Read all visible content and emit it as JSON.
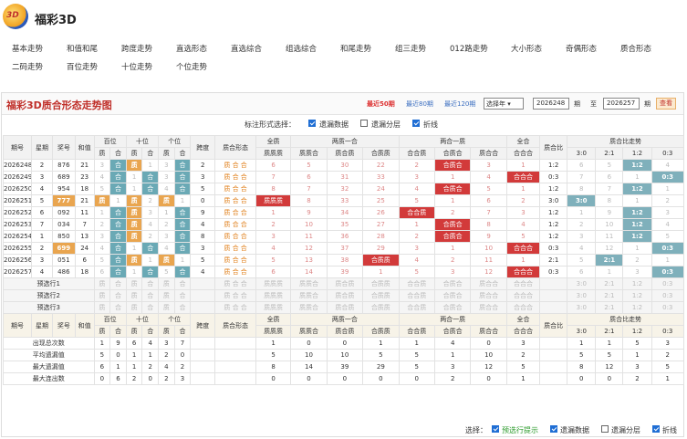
{
  "brand": {
    "logo": "3D",
    "name": "福彩3D"
  },
  "nav": {
    "row1": [
      "基本走势",
      "和值和尾",
      "跨度走势",
      "直选形态",
      "直选综合",
      "组选综合",
      "和尾走势",
      "组三走势",
      "012路走势",
      "大小形态",
      "奇偶形态",
      "质合形态"
    ],
    "row2": [
      "二码走势",
      "百位走势",
      "十位走势",
      "个位走势"
    ]
  },
  "panel": {
    "title": "福彩3D质合形态走势图",
    "recent50": "最近50期",
    "recent80": "最近80期",
    "recent120": "最近120期",
    "select": "选择年",
    "from": "2026248",
    "qi1": "期",
    "to_label": "至",
    "to": "2026257",
    "qi2": "期",
    "query": "查看"
  },
  "options": {
    "label": "标注形式选择：",
    "o1": "遗漏数据",
    "o2": "遗漏分层",
    "o3": "折线"
  },
  "head": {
    "issue": "期号",
    "week": "星期",
    "prize": "奖号",
    "sum": "和值",
    "bai": "百位",
    "shi": "十位",
    "ge": "个位",
    "span": "跨度",
    "form": "质合形态",
    "quan": "全质",
    "lzyh": "两质一合",
    "lhyz": "两合一质",
    "quanhe": "全合",
    "ratio": "质合比",
    "trend": "质合比走势",
    "zhi": "质",
    "he": "合",
    "qz": "质质质",
    "zzh": "质质合",
    "zhz": "质合质",
    "hzz": "合质质",
    "hhz": "合合质",
    "hzh": "合质合",
    "zhh": "质合合",
    "hhh": "合合合",
    "r30": "3:0",
    "r21": "2:1",
    "r12": "1:2",
    "r03": "0:3"
  },
  "rows": [
    [
      "2026248",
      "2",
      "876",
      "21",
      "3",
      "合",
      "质",
      "1",
      "3",
      "合",
      "2",
      "6",
      "5",
      "30",
      "22",
      "2",
      "合质合",
      "3",
      "1",
      "1:2",
      "6",
      "5",
      "1:2",
      "4"
    ],
    [
      "2026249",
      "3",
      "689",
      "23",
      "4",
      "合",
      "1",
      "合",
      "3",
      "合",
      "3",
      "7",
      "6",
      "31",
      "33",
      "3",
      "1",
      "4",
      "合合合",
      "0:3",
      "7",
      "6",
      "1",
      "0:3"
    ],
    [
      "2026250",
      "4",
      "954",
      "18",
      "5",
      "合",
      "1",
      "合",
      "4",
      "合",
      "5",
      "8",
      "7",
      "32",
      "24",
      "4",
      "合质合",
      "5",
      "1",
      "1:2",
      "8",
      "7",
      "1:2",
      "1"
    ],
    [
      "2026251",
      "5",
      "777",
      "21",
      "质",
      "1",
      "质",
      "2",
      "质",
      "1",
      "0",
      "质质质",
      "8",
      "33",
      "25",
      "5",
      "1",
      "6",
      "2",
      "3:0",
      "3:0",
      "8",
      "1",
      "2"
    ],
    [
      "2026252",
      "6",
      "092",
      "11",
      "1",
      "合",
      "质",
      "3",
      "1",
      "合",
      "9",
      "1",
      "9",
      "34",
      "26",
      "合合质",
      "2",
      "7",
      "3",
      "1:2",
      "1",
      "9",
      "1:2",
      "3"
    ],
    [
      "2026253",
      "7",
      "034",
      "7",
      "2",
      "合",
      "质",
      "4",
      "2",
      "合",
      "4",
      "2",
      "10",
      "35",
      "27",
      "1",
      "合质合",
      "8",
      "4",
      "1:2",
      "2",
      "10",
      "1:2",
      "4"
    ],
    [
      "2026254",
      "1",
      "850",
      "13",
      "3",
      "合",
      "质",
      "2",
      "3",
      "合",
      "8",
      "3",
      "11",
      "36",
      "28",
      "2",
      "合质合",
      "9",
      "5",
      "1:2",
      "3",
      "11",
      "1:2",
      "5"
    ],
    [
      "2026255",
      "2",
      "699",
      "24",
      "4",
      "合",
      "1",
      "合",
      "4",
      "合",
      "3",
      "4",
      "12",
      "37",
      "29",
      "3",
      "1",
      "10",
      "合合合",
      "0:3",
      "4",
      "12",
      "1",
      "0:3"
    ],
    [
      "2026256",
      "3",
      "051",
      "6",
      "5",
      "合",
      "质",
      "1",
      "质",
      "1",
      "5",
      "5",
      "13",
      "38",
      "合质质",
      "4",
      "2",
      "11",
      "1",
      "2:1",
      "5",
      "2:1",
      "2",
      "1"
    ],
    [
      "2026257",
      "4",
      "486",
      "18",
      "6",
      "合",
      "1",
      "合",
      "5",
      "合",
      "4",
      "6",
      "14",
      "39",
      "1",
      "5",
      "3",
      "12",
      "合合合",
      "0:3",
      "6",
      "1",
      "3",
      "0:3"
    ]
  ],
  "predict": [
    "预选行1",
    "预选行2",
    "预选行3"
  ],
  "stats": [
    [
      "出现总次数",
      "1",
      "9",
      "6",
      "4",
      "3",
      "7",
      "",
      "",
      "",
      "1",
      "0",
      "0",
      "1",
      "1",
      "4",
      "0",
      "3",
      "",
      "1",
      "1",
      "5",
      "3"
    ],
    [
      "平均遗漏值",
      "5",
      "0",
      "1",
      "1",
      "2",
      "0",
      "",
      "",
      "",
      "5",
      "10",
      "10",
      "5",
      "5",
      "1",
      "10",
      "2",
      "",
      "5",
      "5",
      "1",
      "2"
    ],
    [
      "最大遗漏值",
      "6",
      "1",
      "1",
      "2",
      "4",
      "2",
      "",
      "",
      "",
      "8",
      "14",
      "39",
      "29",
      "5",
      "3",
      "12",
      "5",
      "",
      "8",
      "12",
      "3",
      "5"
    ],
    [
      "最大连出数",
      "0",
      "6",
      "2",
      "0",
      "2",
      "3",
      "",
      "",
      "",
      "0",
      "0",
      "0",
      "0",
      "0",
      "2",
      "0",
      "1",
      "",
      "0",
      "0",
      "2",
      "1"
    ]
  ],
  "footer": {
    "label": "选择：",
    "o1": "预选行提示",
    "o2": "遗漏数据",
    "o3": "遗漏分层",
    "o4": "折线"
  }
}
